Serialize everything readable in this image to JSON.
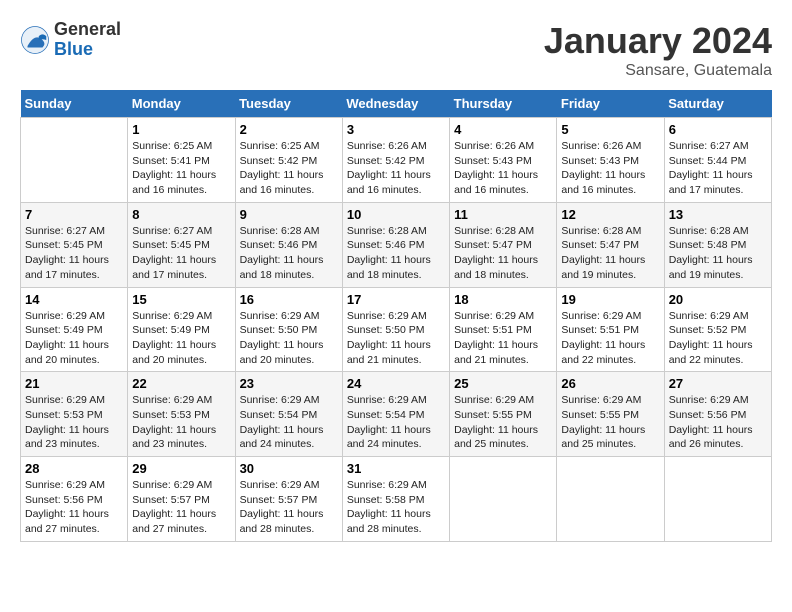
{
  "logo": {
    "general": "General",
    "blue": "Blue"
  },
  "title": "January 2024",
  "location": "Sansare, Guatemala",
  "days_of_week": [
    "Sunday",
    "Monday",
    "Tuesday",
    "Wednesday",
    "Thursday",
    "Friday",
    "Saturday"
  ],
  "weeks": [
    [
      {
        "day": "",
        "info": ""
      },
      {
        "day": "1",
        "info": "Sunrise: 6:25 AM\nSunset: 5:41 PM\nDaylight: 11 hours and 16 minutes."
      },
      {
        "day": "2",
        "info": "Sunrise: 6:25 AM\nSunset: 5:42 PM\nDaylight: 11 hours and 16 minutes."
      },
      {
        "day": "3",
        "info": "Sunrise: 6:26 AM\nSunset: 5:42 PM\nDaylight: 11 hours and 16 minutes."
      },
      {
        "day": "4",
        "info": "Sunrise: 6:26 AM\nSunset: 5:43 PM\nDaylight: 11 hours and 16 minutes."
      },
      {
        "day": "5",
        "info": "Sunrise: 6:26 AM\nSunset: 5:43 PM\nDaylight: 11 hours and 16 minutes."
      },
      {
        "day": "6",
        "info": "Sunrise: 6:27 AM\nSunset: 5:44 PM\nDaylight: 11 hours and 17 minutes."
      }
    ],
    [
      {
        "day": "7",
        "info": "Sunrise: 6:27 AM\nSunset: 5:45 PM\nDaylight: 11 hours and 17 minutes."
      },
      {
        "day": "8",
        "info": "Sunrise: 6:27 AM\nSunset: 5:45 PM\nDaylight: 11 hours and 17 minutes."
      },
      {
        "day": "9",
        "info": "Sunrise: 6:28 AM\nSunset: 5:46 PM\nDaylight: 11 hours and 18 minutes."
      },
      {
        "day": "10",
        "info": "Sunrise: 6:28 AM\nSunset: 5:46 PM\nDaylight: 11 hours and 18 minutes."
      },
      {
        "day": "11",
        "info": "Sunrise: 6:28 AM\nSunset: 5:47 PM\nDaylight: 11 hours and 18 minutes."
      },
      {
        "day": "12",
        "info": "Sunrise: 6:28 AM\nSunset: 5:47 PM\nDaylight: 11 hours and 19 minutes."
      },
      {
        "day": "13",
        "info": "Sunrise: 6:28 AM\nSunset: 5:48 PM\nDaylight: 11 hours and 19 minutes."
      }
    ],
    [
      {
        "day": "14",
        "info": "Sunrise: 6:29 AM\nSunset: 5:49 PM\nDaylight: 11 hours and 20 minutes."
      },
      {
        "day": "15",
        "info": "Sunrise: 6:29 AM\nSunset: 5:49 PM\nDaylight: 11 hours and 20 minutes."
      },
      {
        "day": "16",
        "info": "Sunrise: 6:29 AM\nSunset: 5:50 PM\nDaylight: 11 hours and 20 minutes."
      },
      {
        "day": "17",
        "info": "Sunrise: 6:29 AM\nSunset: 5:50 PM\nDaylight: 11 hours and 21 minutes."
      },
      {
        "day": "18",
        "info": "Sunrise: 6:29 AM\nSunset: 5:51 PM\nDaylight: 11 hours and 21 minutes."
      },
      {
        "day": "19",
        "info": "Sunrise: 6:29 AM\nSunset: 5:51 PM\nDaylight: 11 hours and 22 minutes."
      },
      {
        "day": "20",
        "info": "Sunrise: 6:29 AM\nSunset: 5:52 PM\nDaylight: 11 hours and 22 minutes."
      }
    ],
    [
      {
        "day": "21",
        "info": "Sunrise: 6:29 AM\nSunset: 5:53 PM\nDaylight: 11 hours and 23 minutes."
      },
      {
        "day": "22",
        "info": "Sunrise: 6:29 AM\nSunset: 5:53 PM\nDaylight: 11 hours and 23 minutes."
      },
      {
        "day": "23",
        "info": "Sunrise: 6:29 AM\nSunset: 5:54 PM\nDaylight: 11 hours and 24 minutes."
      },
      {
        "day": "24",
        "info": "Sunrise: 6:29 AM\nSunset: 5:54 PM\nDaylight: 11 hours and 24 minutes."
      },
      {
        "day": "25",
        "info": "Sunrise: 6:29 AM\nSunset: 5:55 PM\nDaylight: 11 hours and 25 minutes."
      },
      {
        "day": "26",
        "info": "Sunrise: 6:29 AM\nSunset: 5:55 PM\nDaylight: 11 hours and 25 minutes."
      },
      {
        "day": "27",
        "info": "Sunrise: 6:29 AM\nSunset: 5:56 PM\nDaylight: 11 hours and 26 minutes."
      }
    ],
    [
      {
        "day": "28",
        "info": "Sunrise: 6:29 AM\nSunset: 5:56 PM\nDaylight: 11 hours and 27 minutes."
      },
      {
        "day": "29",
        "info": "Sunrise: 6:29 AM\nSunset: 5:57 PM\nDaylight: 11 hours and 27 minutes."
      },
      {
        "day": "30",
        "info": "Sunrise: 6:29 AM\nSunset: 5:57 PM\nDaylight: 11 hours and 28 minutes."
      },
      {
        "day": "31",
        "info": "Sunrise: 6:29 AM\nSunset: 5:58 PM\nDaylight: 11 hours and 28 minutes."
      },
      {
        "day": "",
        "info": ""
      },
      {
        "day": "",
        "info": ""
      },
      {
        "day": "",
        "info": ""
      }
    ]
  ]
}
